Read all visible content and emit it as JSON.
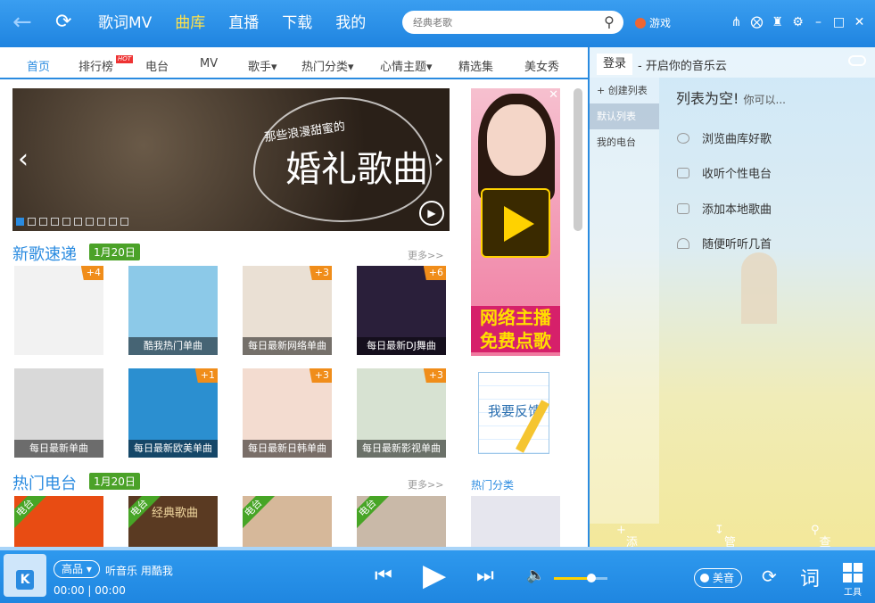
{
  "topbar": {
    "nav": [
      "歌词MV",
      "曲库",
      "直播",
      "下载",
      "我的"
    ],
    "active_index": 1,
    "search_placeholder": "经典老歌",
    "game_label": "游戏",
    "icons": [
      "back-arrow-icon",
      "refresh-icon",
      "search-icon",
      "game-icon",
      "sprout-icon",
      "shrink-icon",
      "shirt-icon",
      "gear-icon",
      "minimize-icon",
      "maximize-icon",
      "close-icon"
    ]
  },
  "subnav": {
    "items": [
      "首页",
      "排行榜",
      "电台",
      "MV",
      "歌手▾",
      "热门分类▾",
      "心情主题▾",
      "精选集",
      "美女秀"
    ],
    "hot_badge": "HOT"
  },
  "banner": {
    "subtitle": "那些浪漫甜蜜的",
    "title": "婚礼歌曲",
    "slide_count": 10,
    "active_slide": 0
  },
  "ad": {
    "text_line1": "网络主播",
    "text_line2": "免费点歌"
  },
  "new_songs": {
    "heading": "新歌速递",
    "date": "1月20日",
    "more": "更多>>",
    "tiles": [
      {
        "caption": "",
        "badge": "+4",
        "color": "#f2f2f2"
      },
      {
        "caption": "酷我热门单曲",
        "badge": "",
        "color": "#8cc9e8"
      },
      {
        "caption": "每日最新网络单曲",
        "badge": "+3",
        "color": "#eae0d4"
      },
      {
        "caption": "每日最新DJ舞曲",
        "badge": "+6",
        "color": "#2a1f3a"
      },
      {
        "caption": "每日最新单曲",
        "badge": "",
        "color": "#d9d9d9"
      },
      {
        "caption": "每日最新欧美单曲",
        "badge": "+1",
        "color": "#2b8fd0"
      },
      {
        "caption": "每日最新日韩单曲",
        "badge": "+3",
        "color": "#f3dcd0"
      },
      {
        "caption": "每日最新影视单曲",
        "badge": "+3",
        "color": "#d7e2d2"
      }
    ]
  },
  "feedback": {
    "label": "我要反馈"
  },
  "radio": {
    "heading": "热门电台",
    "date": "1月20日",
    "more": "更多>>",
    "category_heading": "热门分类",
    "tiles": [
      {
        "ribbon": "",
        "color": "#e84c13"
      },
      {
        "ribbon": "电台",
        "title": "经典歌曲",
        "color": "#5a3a22"
      },
      {
        "ribbon": "电台",
        "color": "#d6b89a"
      },
      {
        "ribbon": "电台",
        "color": "#c9b9a8"
      }
    ]
  },
  "right": {
    "login": "登录",
    "slogan": "- 开启你的音乐云",
    "side": [
      "创建列表",
      "默认列表",
      "我的电台"
    ],
    "empty_title": "列表为空!",
    "empty_hint": "你可以...",
    "actions": [
      "浏览曲库好歌",
      "收听个性电台",
      "添加本地歌曲",
      "随便听听几首"
    ],
    "bottom": [
      "添加",
      "管理",
      "查找"
    ]
  },
  "player": {
    "quality": "高品 ▾",
    "song": "听音乐 用酷我",
    "time": "00:00 | 00:00",
    "effect": "美音",
    "lyrics": "词",
    "tools": "工具",
    "volume": 0.7
  }
}
